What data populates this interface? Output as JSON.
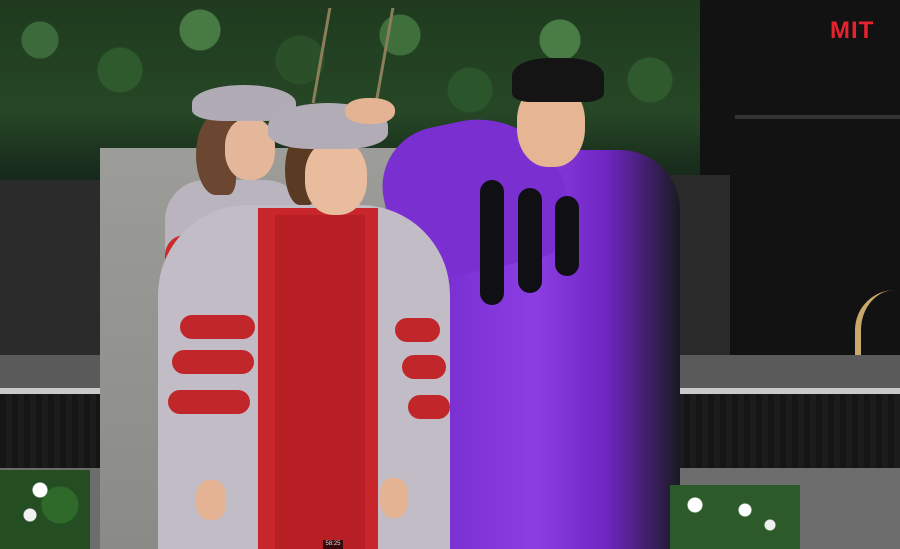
{
  "image": {
    "logo_text": "MIT",
    "timestamp": "58:25"
  },
  "colors": {
    "logo": "#e8232f",
    "robe_purple": "#7a2fd1",
    "robe_red": "#c8262b",
    "robe_gray": "#c2bcc6"
  }
}
